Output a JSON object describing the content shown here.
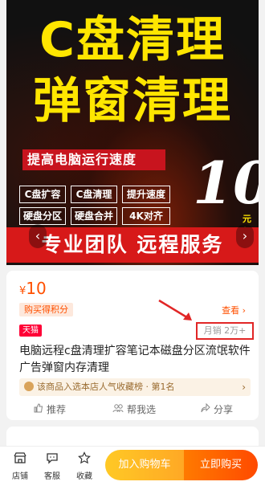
{
  "hero": {
    "line1": "C盘清理",
    "line2": "弹窗清理",
    "subtitle": "提高电脑运行速度",
    "tags": [
      "C盘扩容",
      "C盘清理",
      "提升速度",
      "硬盘分区",
      "硬盘合并",
      "4K对齐"
    ],
    "big_number": "10",
    "price_suffix": "元起",
    "band": "专业团队 远程服务",
    "prev_arrow": "‹",
    "next_arrow": "›"
  },
  "product": {
    "currency": "¥",
    "price": "10",
    "points_badge": "购买得积分",
    "view_link": "查看 ›",
    "store_badge": "天猫",
    "sales": "月销 2万+",
    "title": "电脑远程c盘清理扩容笔记本磁盘分区流氓软件广告弹窗内存清理",
    "rank": "该商品入选本店人气收藏榜 · 第1名",
    "rank_chevron": "›",
    "actions": [
      {
        "icon": "thumb-icon",
        "label": "推荐"
      },
      {
        "icon": "users-icon",
        "label": "帮我选"
      },
      {
        "icon": "share-icon",
        "label": "分享"
      }
    ]
  },
  "bottom_bar": {
    "items": [
      {
        "icon": "store-icon",
        "label": "店铺"
      },
      {
        "icon": "chat-icon",
        "label": "客服"
      },
      {
        "icon": "star-icon",
        "label": "收藏"
      }
    ],
    "add_to_cart": "加入购物车",
    "buy_now": "立即购买"
  },
  "colors": {
    "accent": "#ff5000",
    "hero_yellow": "#ffe600",
    "hero_red": "#d71919",
    "highlight_box": "#e12626"
  }
}
